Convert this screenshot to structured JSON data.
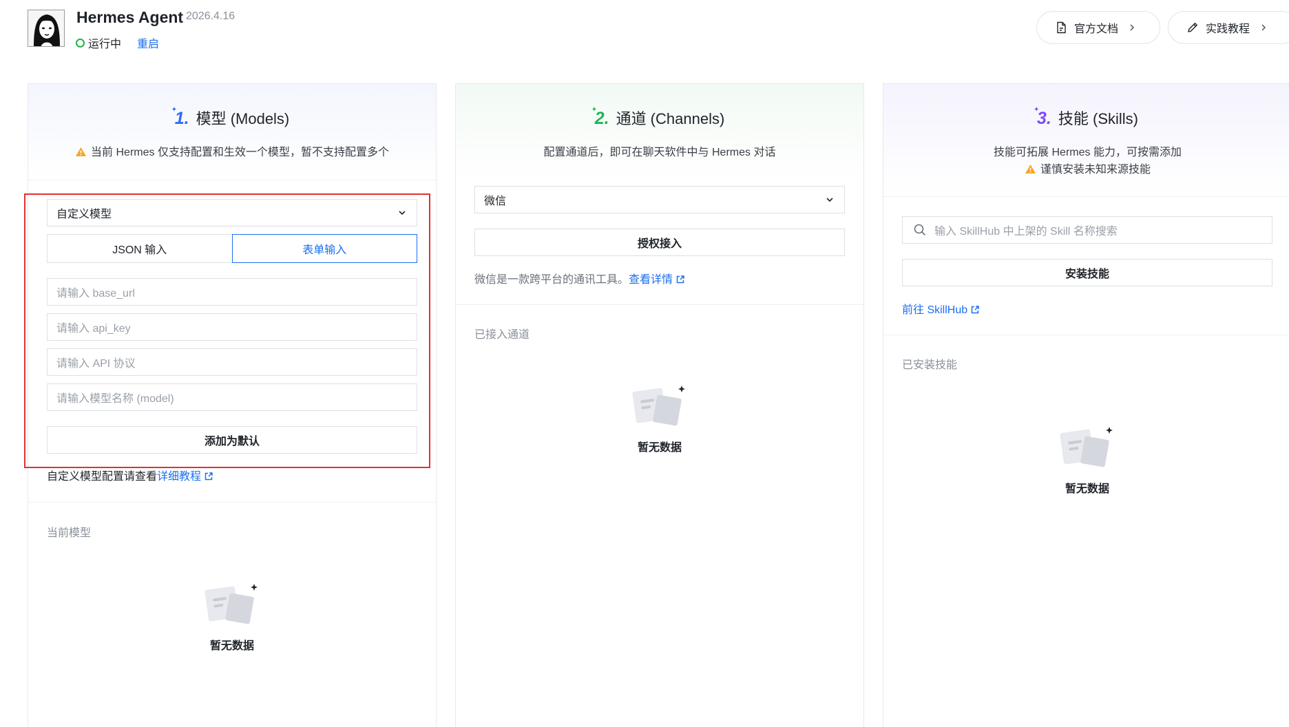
{
  "header": {
    "app_name": "Hermes Agent",
    "version": "2026.4.16",
    "status": "运行中",
    "restart": "重启",
    "docs_button": "官方文档",
    "tutorial_button": "实践教程",
    "status_color": "#20b24a",
    "accent_color": "#1a6ff0"
  },
  "models": {
    "number": "1.",
    "title": "模型 (Models)",
    "notice": "当前 Hermes 仅支持配置和生效一个模型，暂不支持配置多个",
    "model_select": "自定义模型",
    "tabs": [
      "JSON 输入",
      "表单输入"
    ],
    "active_tab": "表单输入",
    "base_url_placeholder": "请输入 base_url",
    "api_key_placeholder": "请输入 api_key",
    "protocol_placeholder": "请输入 API 协议",
    "model_name_placeholder": "请输入模型名称 (model)",
    "add_default_button": "添加为默认",
    "help_text": "自定义模型配置请查看",
    "help_link": "详细教程",
    "current_label": "当前模型",
    "empty_text": "暂无数据"
  },
  "channels": {
    "number": "2.",
    "title": "通道 (Channels)",
    "description": "配置通道后，即可在聊天软件中与 Hermes 对话",
    "channel_select": "微信",
    "authorize_button": "授权接入",
    "info_text": "微信是一款跨平台的通讯工具。",
    "info_link": "查看详情",
    "connected_label": "已接入通道",
    "empty_text": "暂无数据"
  },
  "skills": {
    "number": "3.",
    "title": "技能 (Skills)",
    "description": "技能可拓展 Hermes 能力，可按需添加",
    "warning": "谨慎安装未知来源技能",
    "search_placeholder": "输入 SkillHub 中上架的 Skill 名称搜索",
    "install_button": "安装技能",
    "skillhub_link": "前往 SkillHub",
    "installed_label": "已安装技能",
    "empty_text": "暂无数据"
  }
}
